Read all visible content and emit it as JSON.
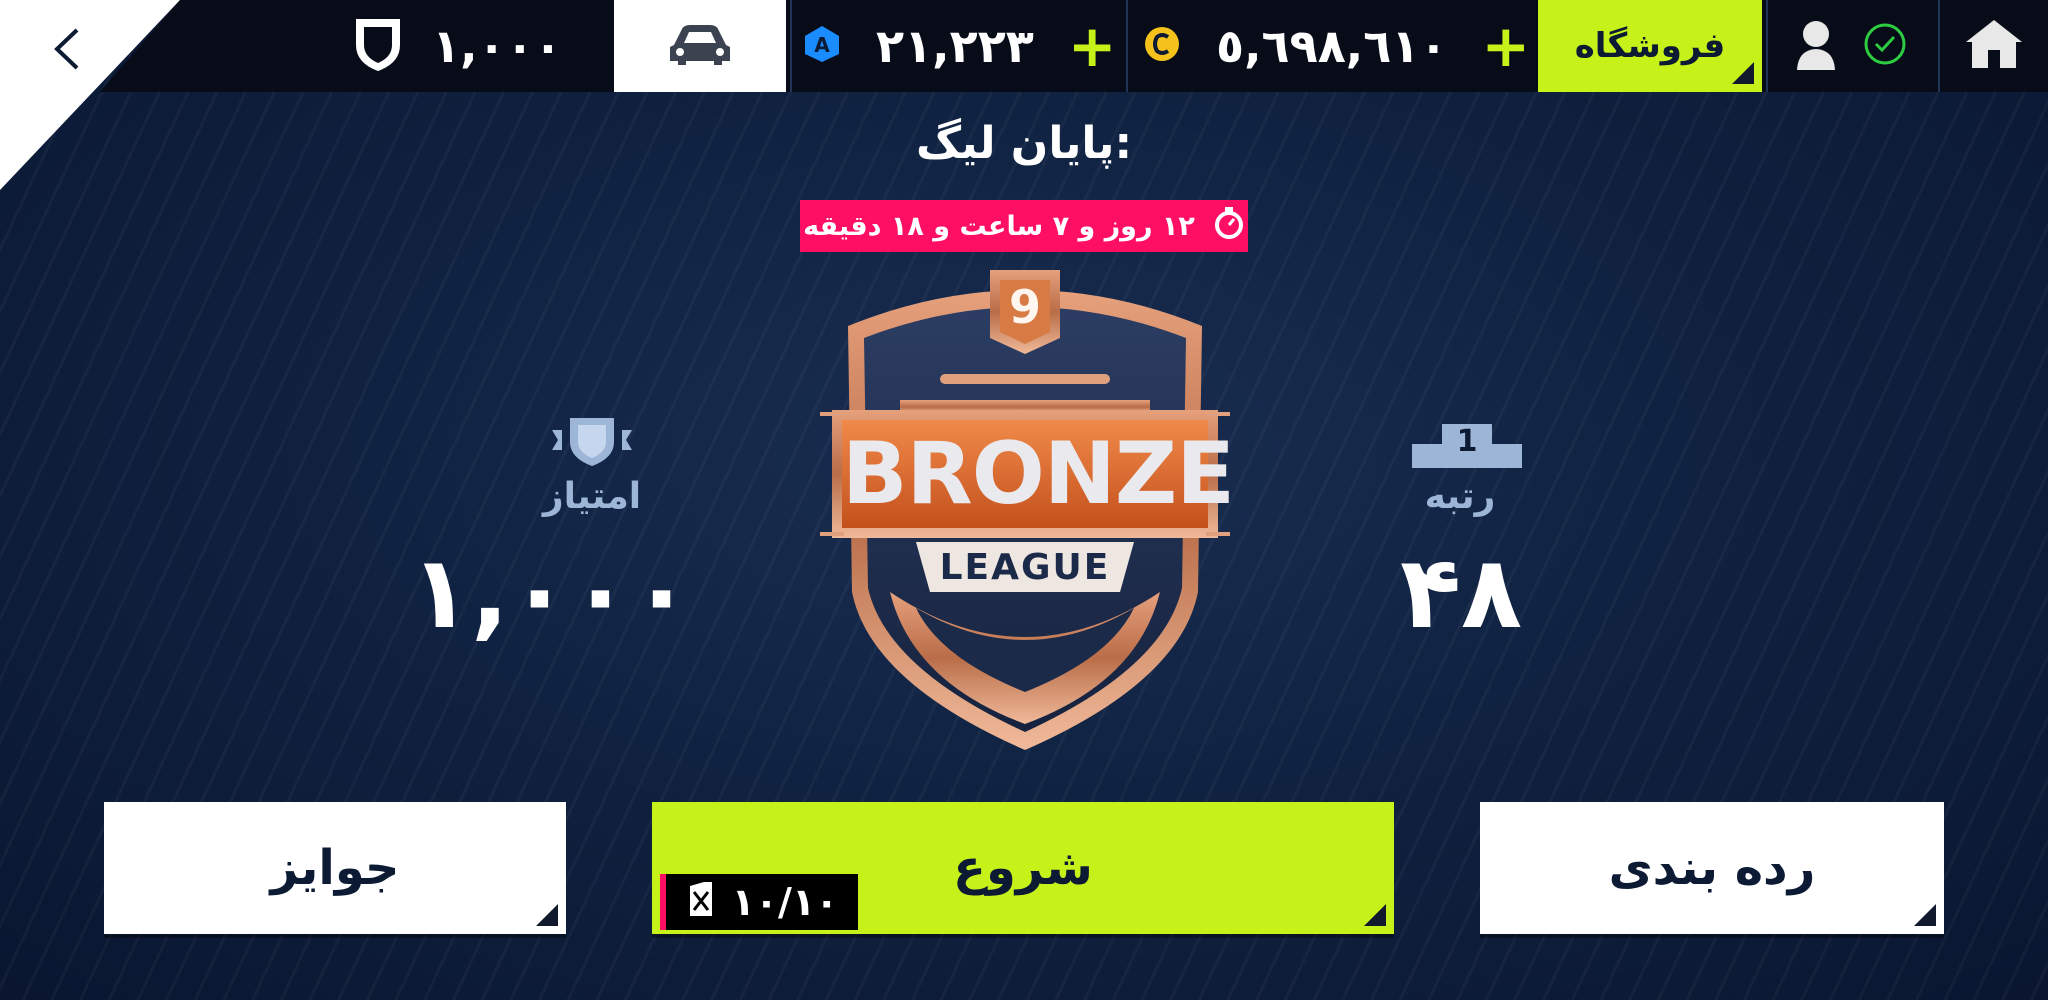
{
  "topbar": {
    "league_points": "١,٠٠٠",
    "tokens": "٢١,٢٢٣",
    "credits": "٥,٦٩٨,٦١٠",
    "shop_label": "فروشگاه"
  },
  "league": {
    "title": "پایان لیگ:",
    "time_left": "١٢ روز و ٧ ساعت و ١٨ دقیقه",
    "badge_number": "9",
    "badge_title": "BRONZE",
    "badge_subtitle": "LEAGUE"
  },
  "stats": {
    "points_label": "امتیاز",
    "points_value": "١,٠٠٠",
    "rank_label": "رتبه",
    "rank_value": "۴٨",
    "podium_number": "1"
  },
  "buttons": {
    "prizes_label": "جوایز",
    "start_label": "شروع",
    "ranking_label": "رده بندی",
    "fuel_value": "١٠/١٠"
  },
  "colors": {
    "accent_green": "#c6f21a",
    "timer_pink": "#ff0f63",
    "background": "#0c1a33",
    "bronze": "#c8805a"
  },
  "icons": [
    "back-chevron-icon",
    "shield-icon",
    "car-icon",
    "token-icon",
    "credit-icon",
    "plus-icon",
    "check-circle-icon",
    "profile-icon",
    "home-icon",
    "stopwatch-icon",
    "podium-icon",
    "fuel-icon"
  ]
}
